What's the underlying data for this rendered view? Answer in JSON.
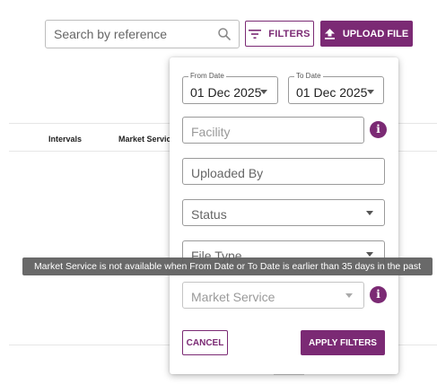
{
  "toolbar": {
    "search_placeholder": "Search by reference",
    "search_icon": "search-icon",
    "filters_label": "FILTERS",
    "filters_icon": "filter-lines-icon",
    "upload_label": "UPLOAD FILE",
    "upload_icon": "upload-arrow-icon"
  },
  "table": {
    "columns": [
      "Intervals",
      "Market Service"
    ]
  },
  "filters": {
    "from_date": {
      "label": "From Date",
      "value": "01 Dec 2025"
    },
    "to_date": {
      "label": "To Date",
      "value": "01 Dec 2025"
    },
    "facility_placeholder": "Facility",
    "uploaded_by_placeholder": "Uploaded By",
    "status_label": "Status",
    "file_type_label": "File Type",
    "market_service_label": "Market Service",
    "info_glyph": "i",
    "cancel_label": "CANCEL",
    "apply_label": "APPLY FILTERS"
  },
  "tooltip": {
    "text": "Market Service is not available when From Date or To Date is earlier than 35 days in the past"
  },
  "colors": {
    "brand": "#7b2a74",
    "tooltip_bg": "#616161"
  }
}
